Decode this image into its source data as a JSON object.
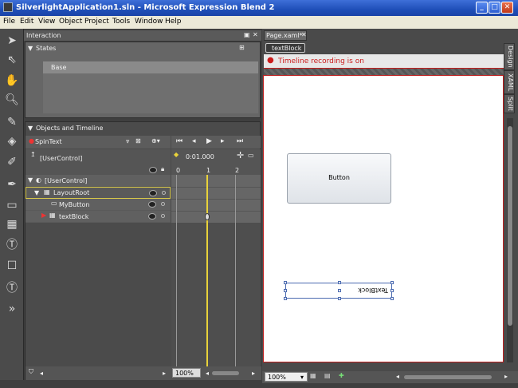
{
  "window": {
    "title": "SilverlightApplication1.sln - Microsoft Expression Blend 2",
    "minimize": "_",
    "maximize": "□",
    "close": "✕"
  },
  "menu": [
    "File",
    "Edit",
    "View",
    "Object",
    "Project",
    "Tools",
    "Window",
    "Help"
  ],
  "interaction": {
    "title": "Interaction",
    "states_title": "States",
    "base_state": "Base",
    "objects_title": "Objects and Timeline",
    "storyboard": "SpinText",
    "scope": "[UserControl]",
    "time": "0:01.000",
    "ruler": [
      "0",
      "1",
      "2"
    ],
    "tree": [
      {
        "label": "[UserControl]",
        "indent": 0
      },
      {
        "label": "LayoutRoot",
        "indent": 1
      },
      {
        "label": "MyButton",
        "indent": 2
      },
      {
        "label": "textBlock",
        "indent": 2
      }
    ],
    "zoom": "100%"
  },
  "document": {
    "tab": "Page.xaml*",
    "breadcrumb": "textBlock",
    "recording_text": "Timeline recording is on",
    "button_label": "Button",
    "textblock_text": "TextBlock",
    "zoom": "100%",
    "view_tabs": [
      "Design",
      "XAML",
      "Split"
    ]
  },
  "colors": {
    "record": "#cc1b1b",
    "selection": "#d8c84a",
    "playhead": "#e8d23a"
  }
}
